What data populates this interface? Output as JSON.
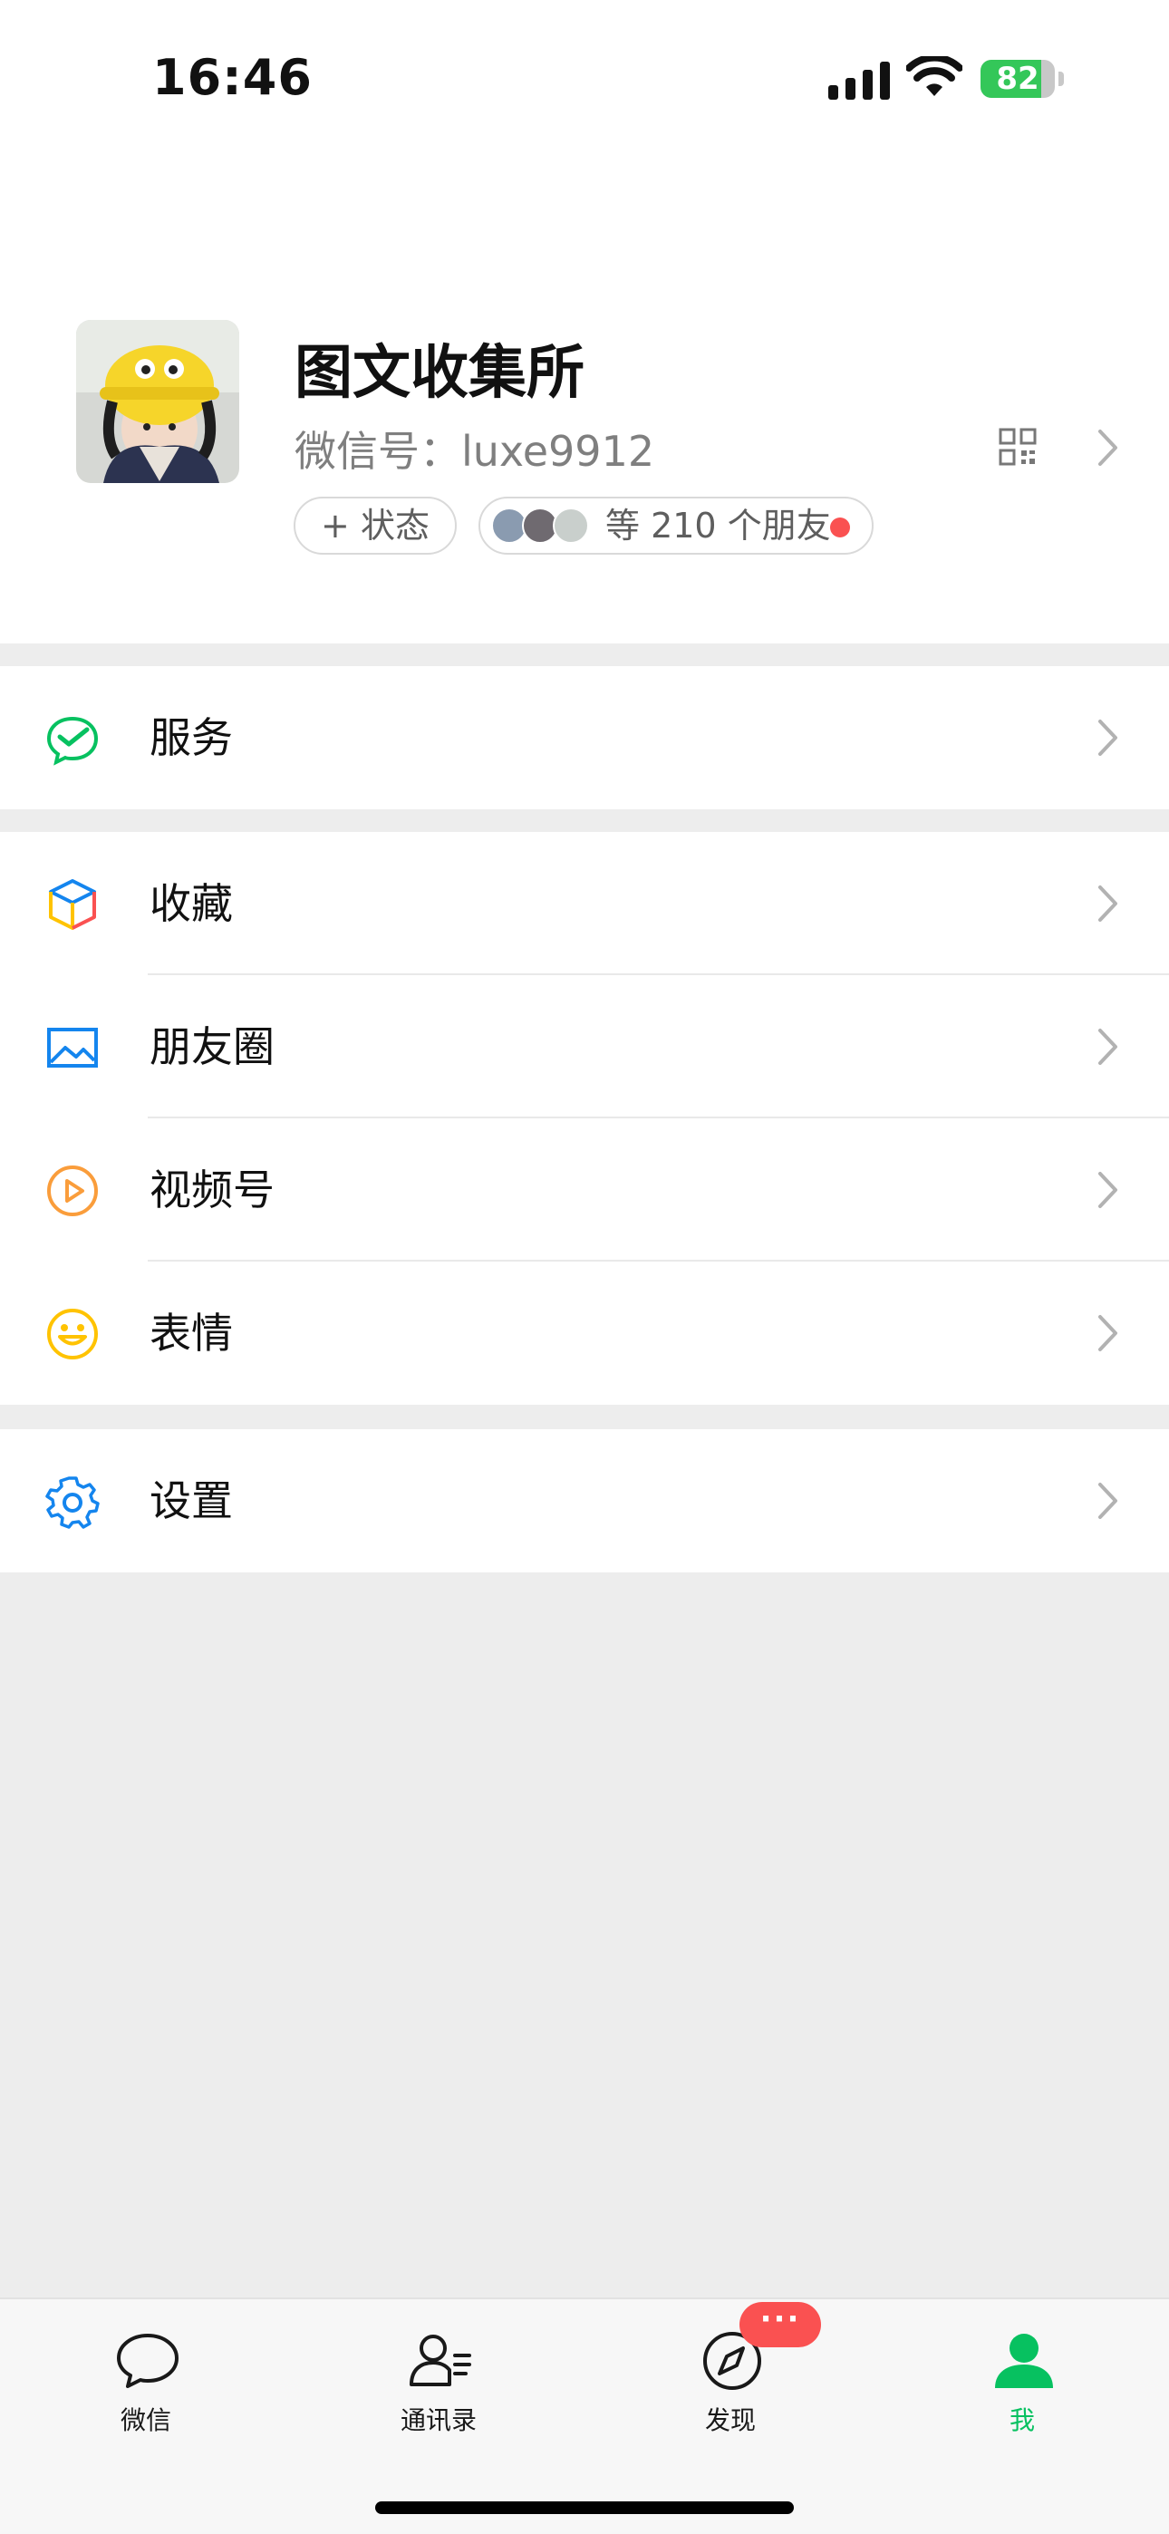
{
  "status_bar": {
    "time": "16:46",
    "battery_level": 82,
    "battery_text": "82",
    "charging": true
  },
  "profile": {
    "nickname": "图文收集所",
    "wechat_id": "微信号：luxe9912",
    "status_button": "+ 状态",
    "friends_text": "等 210 个朋友",
    "unread_dot": true
  },
  "menu": {
    "services": {
      "label": "服务",
      "icon": "wechat-pay-icon"
    },
    "favorites": {
      "label": "收藏",
      "icon": "cube-icon"
    },
    "moments": {
      "label": "朋友圈",
      "icon": "picture-icon"
    },
    "channels": {
      "label": "视频号",
      "icon": "play-icon"
    },
    "stickers": {
      "label": "表情",
      "icon": "smiley-icon"
    },
    "settings": {
      "label": "设置",
      "icon": "gear-icon"
    }
  },
  "tabbar": {
    "tabs": [
      {
        "label": "微信",
        "icon": "chat-bubble-icon"
      },
      {
        "label": "通讯录",
        "icon": "contacts-icon"
      },
      {
        "label": "发现",
        "icon": "compass-icon"
      },
      {
        "label": "我",
        "icon": "person-icon"
      }
    ],
    "active_tab": "我",
    "discover_badge": "···"
  },
  "colors": {
    "accent_green": "#07c160",
    "badge_red": "#fa5151",
    "background": "#ededed",
    "icon_blue": "#1485ee",
    "icon_orange": "#fa9d3b",
    "icon_yellow": "#ffc300"
  }
}
